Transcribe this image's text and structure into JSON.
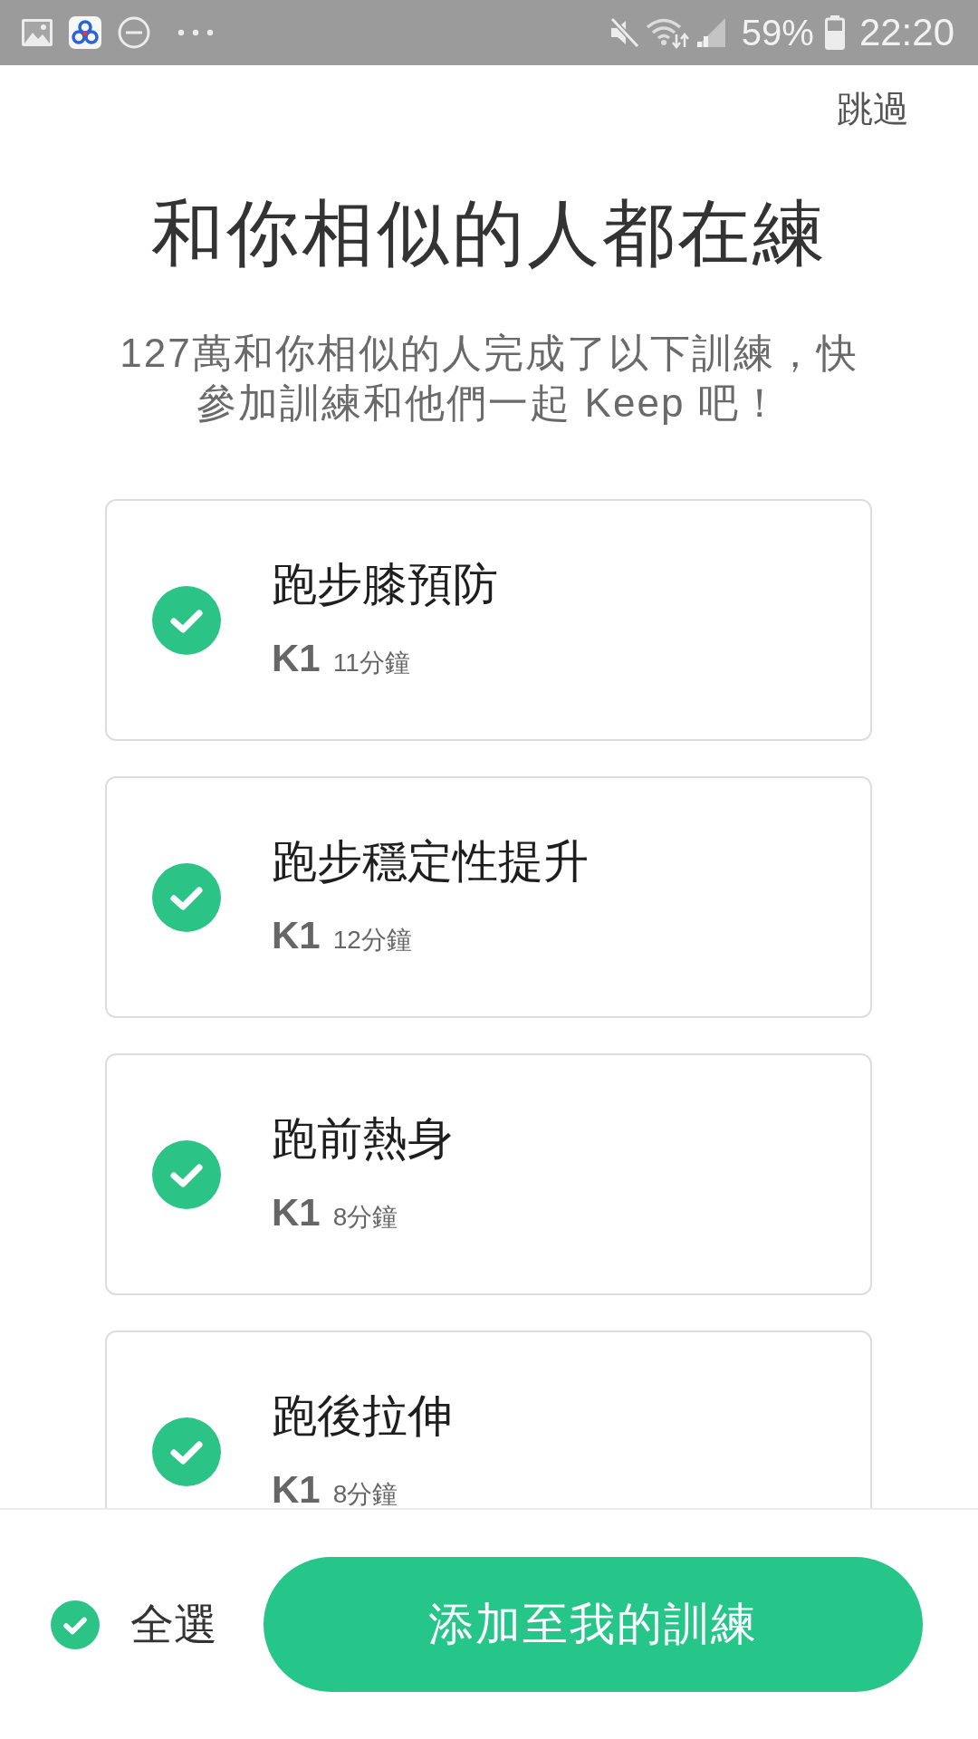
{
  "status_bar": {
    "battery": "59%",
    "time": "22:20"
  },
  "header": {
    "skip": "跳過"
  },
  "title": "和你相似的人都在練",
  "subtitle": "127萬和你相似的人完成了以下訓練，快參加訓練和他們一起 Keep 吧！",
  "trainings": [
    {
      "title": "跑步膝預防",
      "grade": "K1",
      "duration": "11分鐘",
      "checked": true
    },
    {
      "title": "跑步穩定性提升",
      "grade": "K1",
      "duration": "12分鐘",
      "checked": true
    },
    {
      "title": "跑前熱身",
      "grade": "K1",
      "duration": "8分鐘",
      "checked": true
    },
    {
      "title": "跑後拉伸",
      "grade": "K1",
      "duration": "8分鐘",
      "checked": true
    }
  ],
  "footer": {
    "select_all": {
      "label": "全選",
      "checked": true
    },
    "add_button": "添加至我的訓練"
  }
}
